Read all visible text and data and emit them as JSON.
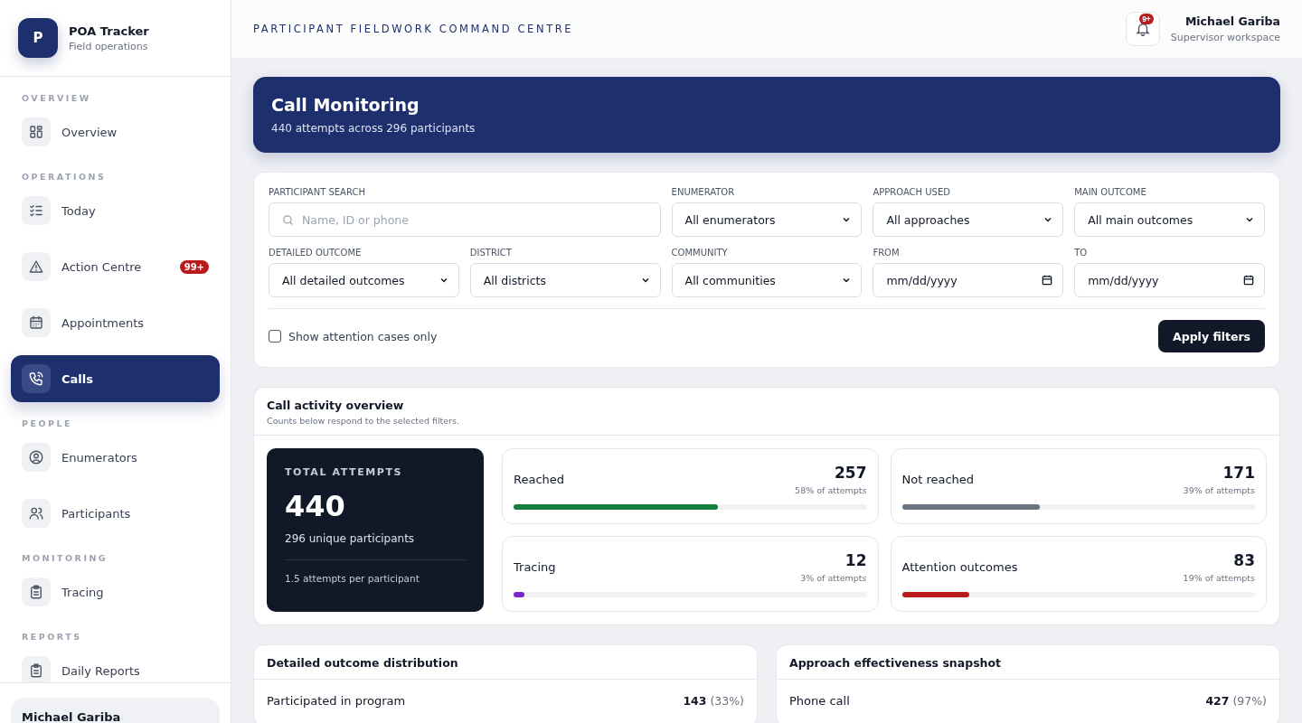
{
  "brand": {
    "logo_letter": "P",
    "name": "POA Tracker",
    "subtitle": "Field operations"
  },
  "sidebar": {
    "sections": [
      {
        "heading": "OVERVIEW",
        "items": [
          {
            "label": "Overview",
            "selected": false
          }
        ]
      },
      {
        "heading": "OPERATIONS",
        "items": [
          {
            "label": "Today",
            "selected": false
          },
          {
            "label": "Action Centre",
            "selected": false,
            "badge": "99+"
          },
          {
            "label": "Appointments",
            "selected": false
          },
          {
            "label": "Calls",
            "selected": true
          }
        ]
      },
      {
        "heading": "PEOPLE",
        "items": [
          {
            "label": "Enumerators",
            "selected": false
          },
          {
            "label": "Participants",
            "selected": false
          }
        ]
      },
      {
        "heading": "MONITORING",
        "items": [
          {
            "label": "Tracing",
            "selected": false
          }
        ]
      },
      {
        "heading": "REPORTS",
        "items": [
          {
            "label": "Daily Reports",
            "selected": false
          }
        ]
      }
    ],
    "user": "Michael Gariba"
  },
  "header": {
    "title": "PARTICIPANT FIELDWORK COMMAND CENTRE",
    "notification_badge": "9+",
    "user_name": "Michael Gariba",
    "user_role": "Supervisor workspace"
  },
  "banner": {
    "title": "Call Monitoring",
    "subtitle": "440 attempts across 296 participants"
  },
  "filters": {
    "fields": [
      {
        "kind": "search",
        "label": "PARTICIPANT SEARCH",
        "placeholder": "Name, ID or phone"
      },
      {
        "kind": "select",
        "label": "ENUMERATOR",
        "value": "All enumerators"
      },
      {
        "kind": "select",
        "label": "APPROACH USED",
        "value": "All approaches"
      },
      {
        "kind": "select",
        "label": "MAIN OUTCOME",
        "value": "All main outcomes"
      },
      {
        "kind": "select",
        "label": "DETAILED OUTCOME",
        "value": "All detailed outcomes"
      },
      {
        "kind": "select",
        "label": "DISTRICT",
        "value": "All districts"
      },
      {
        "kind": "select",
        "label": "COMMUNITY",
        "value": "All communities"
      },
      {
        "kind": "date",
        "label": "FROM",
        "value": "mm/dd/yyyy"
      },
      {
        "kind": "date",
        "label": "TO",
        "value": "mm/dd/yyyy"
      }
    ],
    "attention_only": {
      "label": "Show attention cases only",
      "checked": false
    },
    "apply_button": "Apply filters"
  },
  "overview": {
    "title": "Call activity overview",
    "subtitle": "Counts below respond to the selected filters.",
    "total": {
      "label": "TOTAL ATTEMPTS",
      "value": "440",
      "unique": "296 unique participants",
      "per_participant": "1.5 attempts per participant"
    },
    "stats": [
      {
        "label": "Reached",
        "value": "257",
        "share": "58% of attempts",
        "level": 0.58,
        "color": "#15803d"
      },
      {
        "label": "Not reached",
        "value": "171",
        "share": "39% of attempts",
        "level": 0.39,
        "color": "#6b7280"
      },
      {
        "label": "Tracing",
        "value": "12",
        "share": "3% of attempts",
        "level": 0.03,
        "color": "#7e22ce"
      },
      {
        "label": "Attention outcomes",
        "value": "83",
        "share": "19% of attempts",
        "level": 0.19,
        "color": "#b91c1c"
      }
    ]
  },
  "panels": [
    {
      "title": "Detailed outcome distribution",
      "rows": [
        {
          "label": "Participated in program",
          "count": "143",
          "share": "(33%)"
        }
      ]
    },
    {
      "title": "Approach effectiveness snapshot",
      "rows": [
        {
          "label": "Phone call",
          "count": "427",
          "share": "(97%)"
        }
      ]
    }
  ]
}
